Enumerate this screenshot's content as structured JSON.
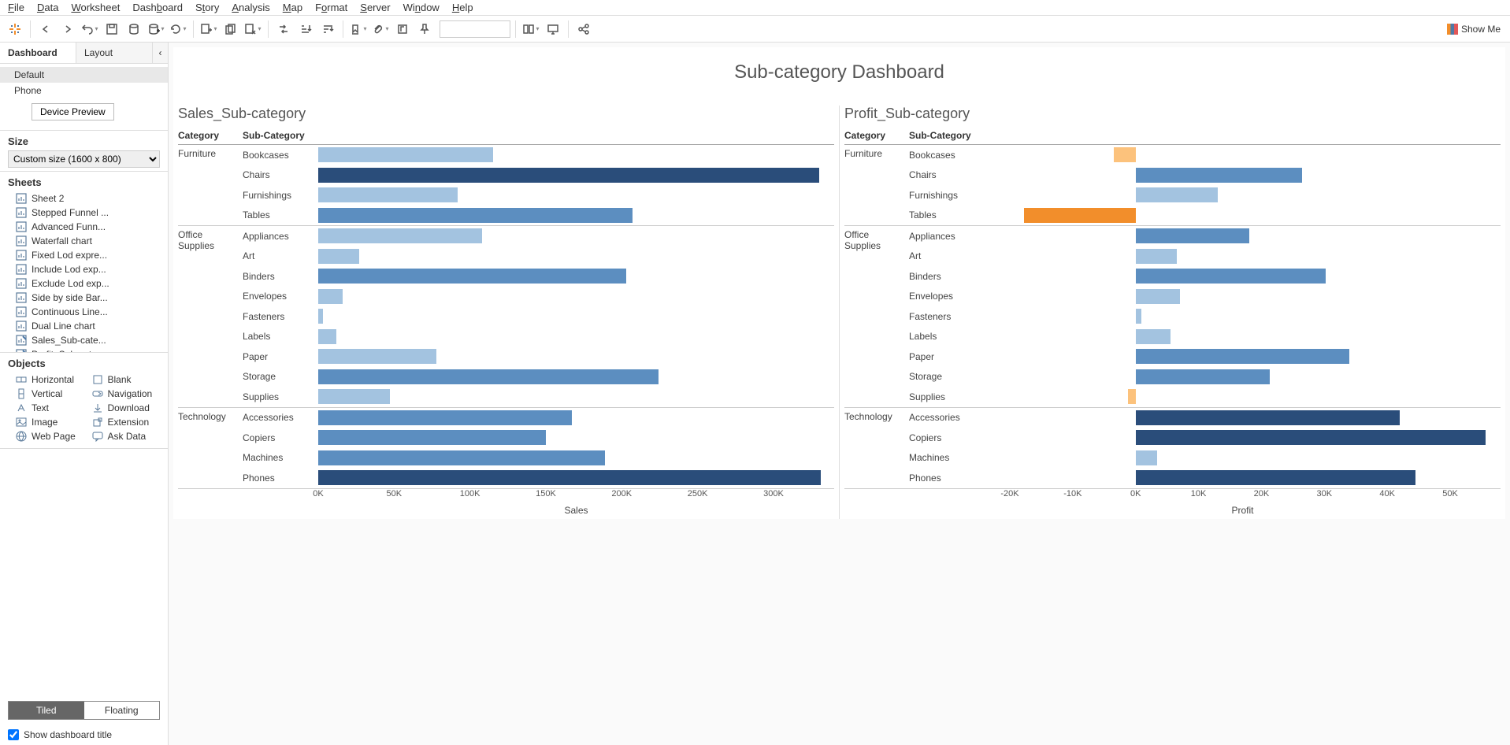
{
  "menu": [
    "File",
    "Data",
    "Worksheet",
    "Dashboard",
    "Story",
    "Analysis",
    "Map",
    "Format",
    "Server",
    "Window",
    "Help"
  ],
  "menu_underline": [
    "F",
    "D",
    "W",
    "b",
    "t",
    "A",
    "M",
    "o",
    "S",
    "n",
    "H"
  ],
  "showme": "Show Me",
  "sidebar": {
    "tabs": [
      "Dashboard",
      "Layout"
    ],
    "devices": [
      "Default",
      "Phone"
    ],
    "device_preview": "Device Preview",
    "size_label": "Size",
    "size_value": "Custom size (1600 x 800)",
    "sheets_label": "Sheets",
    "sheets": [
      "Sheet 2",
      "Stepped Funnel ...",
      "Advanced Funn...",
      "Waterfall chart",
      "Fixed Lod expre...",
      "Include Lod exp...",
      "Exclude Lod exp...",
      "Side by side Bar...",
      "Continuous Line...",
      "Dual Line chart",
      "Sales_Sub-cate...",
      "Profit_Sub-cate..."
    ],
    "sheets_used": [
      10,
      11
    ],
    "objects_label": "Objects",
    "objects_left": [
      "Horizontal",
      "Vertical",
      "Text",
      "Image",
      "Web Page"
    ],
    "objects_right": [
      "Blank",
      "Navigation",
      "Download",
      "Extension",
      "Ask Data"
    ],
    "tiled": "Tiled",
    "floating": "Floating",
    "show_title": "Show dashboard title"
  },
  "dashboard_title": "Sub-category Dashboard",
  "chart_data": [
    {
      "type": "bar",
      "title": "Sales_Sub-category",
      "xlabel": "Sales",
      "cat_header": "Category",
      "sub_header": "Sub-Category",
      "xlim": [
        0,
        340000
      ],
      "ticks": [
        "0K",
        "50K",
        "100K",
        "150K",
        "200K",
        "250K",
        "300K"
      ],
      "tick_vals": [
        0,
        50000,
        100000,
        150000,
        200000,
        250000,
        300000
      ],
      "groups": [
        {
          "category": "Furniture",
          "items": [
            {
              "name": "Bookcases",
              "value": 115000,
              "color": "l"
            },
            {
              "name": "Chairs",
              "value": 330000,
              "color": "d"
            },
            {
              "name": "Furnishings",
              "value": 92000,
              "color": "l"
            },
            {
              "name": "Tables",
              "value": 207000,
              "color": "m"
            }
          ]
        },
        {
          "category": "Office Supplies",
          "items": [
            {
              "name": "Appliances",
              "value": 108000,
              "color": "l"
            },
            {
              "name": "Art",
              "value": 27000,
              "color": "l"
            },
            {
              "name": "Binders",
              "value": 203000,
              "color": "m"
            },
            {
              "name": "Envelopes",
              "value": 16000,
              "color": "l"
            },
            {
              "name": "Fasteners",
              "value": 3000,
              "color": "l"
            },
            {
              "name": "Labels",
              "value": 12000,
              "color": "l"
            },
            {
              "name": "Paper",
              "value": 78000,
              "color": "l"
            },
            {
              "name": "Storage",
              "value": 224000,
              "color": "m"
            },
            {
              "name": "Supplies",
              "value": 47000,
              "color": "l"
            }
          ]
        },
        {
          "category": "Technology",
          "items": [
            {
              "name": "Accessories",
              "value": 167000,
              "color": "m"
            },
            {
              "name": "Copiers",
              "value": 150000,
              "color": "m"
            },
            {
              "name": "Machines",
              "value": 189000,
              "color": "m"
            },
            {
              "name": "Phones",
              "value": 331000,
              "color": "d"
            }
          ]
        }
      ]
    },
    {
      "type": "bar",
      "title": "Profit_Sub-category",
      "xlabel": "Profit",
      "cat_header": "Category",
      "sub_header": "Sub-Category",
      "xlim": [
        -24000,
        58000
      ],
      "ticks": [
        "-20K",
        "-10K",
        "0K",
        "10K",
        "20K",
        "30K",
        "40K",
        "50K"
      ],
      "tick_vals": [
        -20000,
        -10000,
        0,
        10000,
        20000,
        30000,
        40000,
        50000
      ],
      "groups": [
        {
          "category": "Furniture",
          "items": [
            {
              "name": "Bookcases",
              "value": -3500,
              "color": "neg-l"
            },
            {
              "name": "Chairs",
              "value": 26500,
              "color": "m"
            },
            {
              "name": "Furnishings",
              "value": 13000,
              "color": "l"
            },
            {
              "name": "Tables",
              "value": -17700,
              "color": "neg-d"
            }
          ]
        },
        {
          "category": "Office Supplies",
          "items": [
            {
              "name": "Appliances",
              "value": 18100,
              "color": "m"
            },
            {
              "name": "Art",
              "value": 6500,
              "color": "l"
            },
            {
              "name": "Binders",
              "value": 30200,
              "color": "m"
            },
            {
              "name": "Envelopes",
              "value": 7000,
              "color": "l"
            },
            {
              "name": "Fasteners",
              "value": 950,
              "color": "l"
            },
            {
              "name": "Labels",
              "value": 5500,
              "color": "l"
            },
            {
              "name": "Paper",
              "value": 34000,
              "color": "m"
            },
            {
              "name": "Storage",
              "value": 21300,
              "color": "m"
            },
            {
              "name": "Supplies",
              "value": -1200,
              "color": "neg-l"
            }
          ]
        },
        {
          "category": "Technology",
          "items": [
            {
              "name": "Accessories",
              "value": 42000,
              "color": "d"
            },
            {
              "name": "Copiers",
              "value": 55600,
              "color": "d"
            },
            {
              "name": "Machines",
              "value": 3400,
              "color": "l"
            },
            {
              "name": "Phones",
              "value": 44500,
              "color": "d"
            }
          ]
        }
      ]
    }
  ]
}
